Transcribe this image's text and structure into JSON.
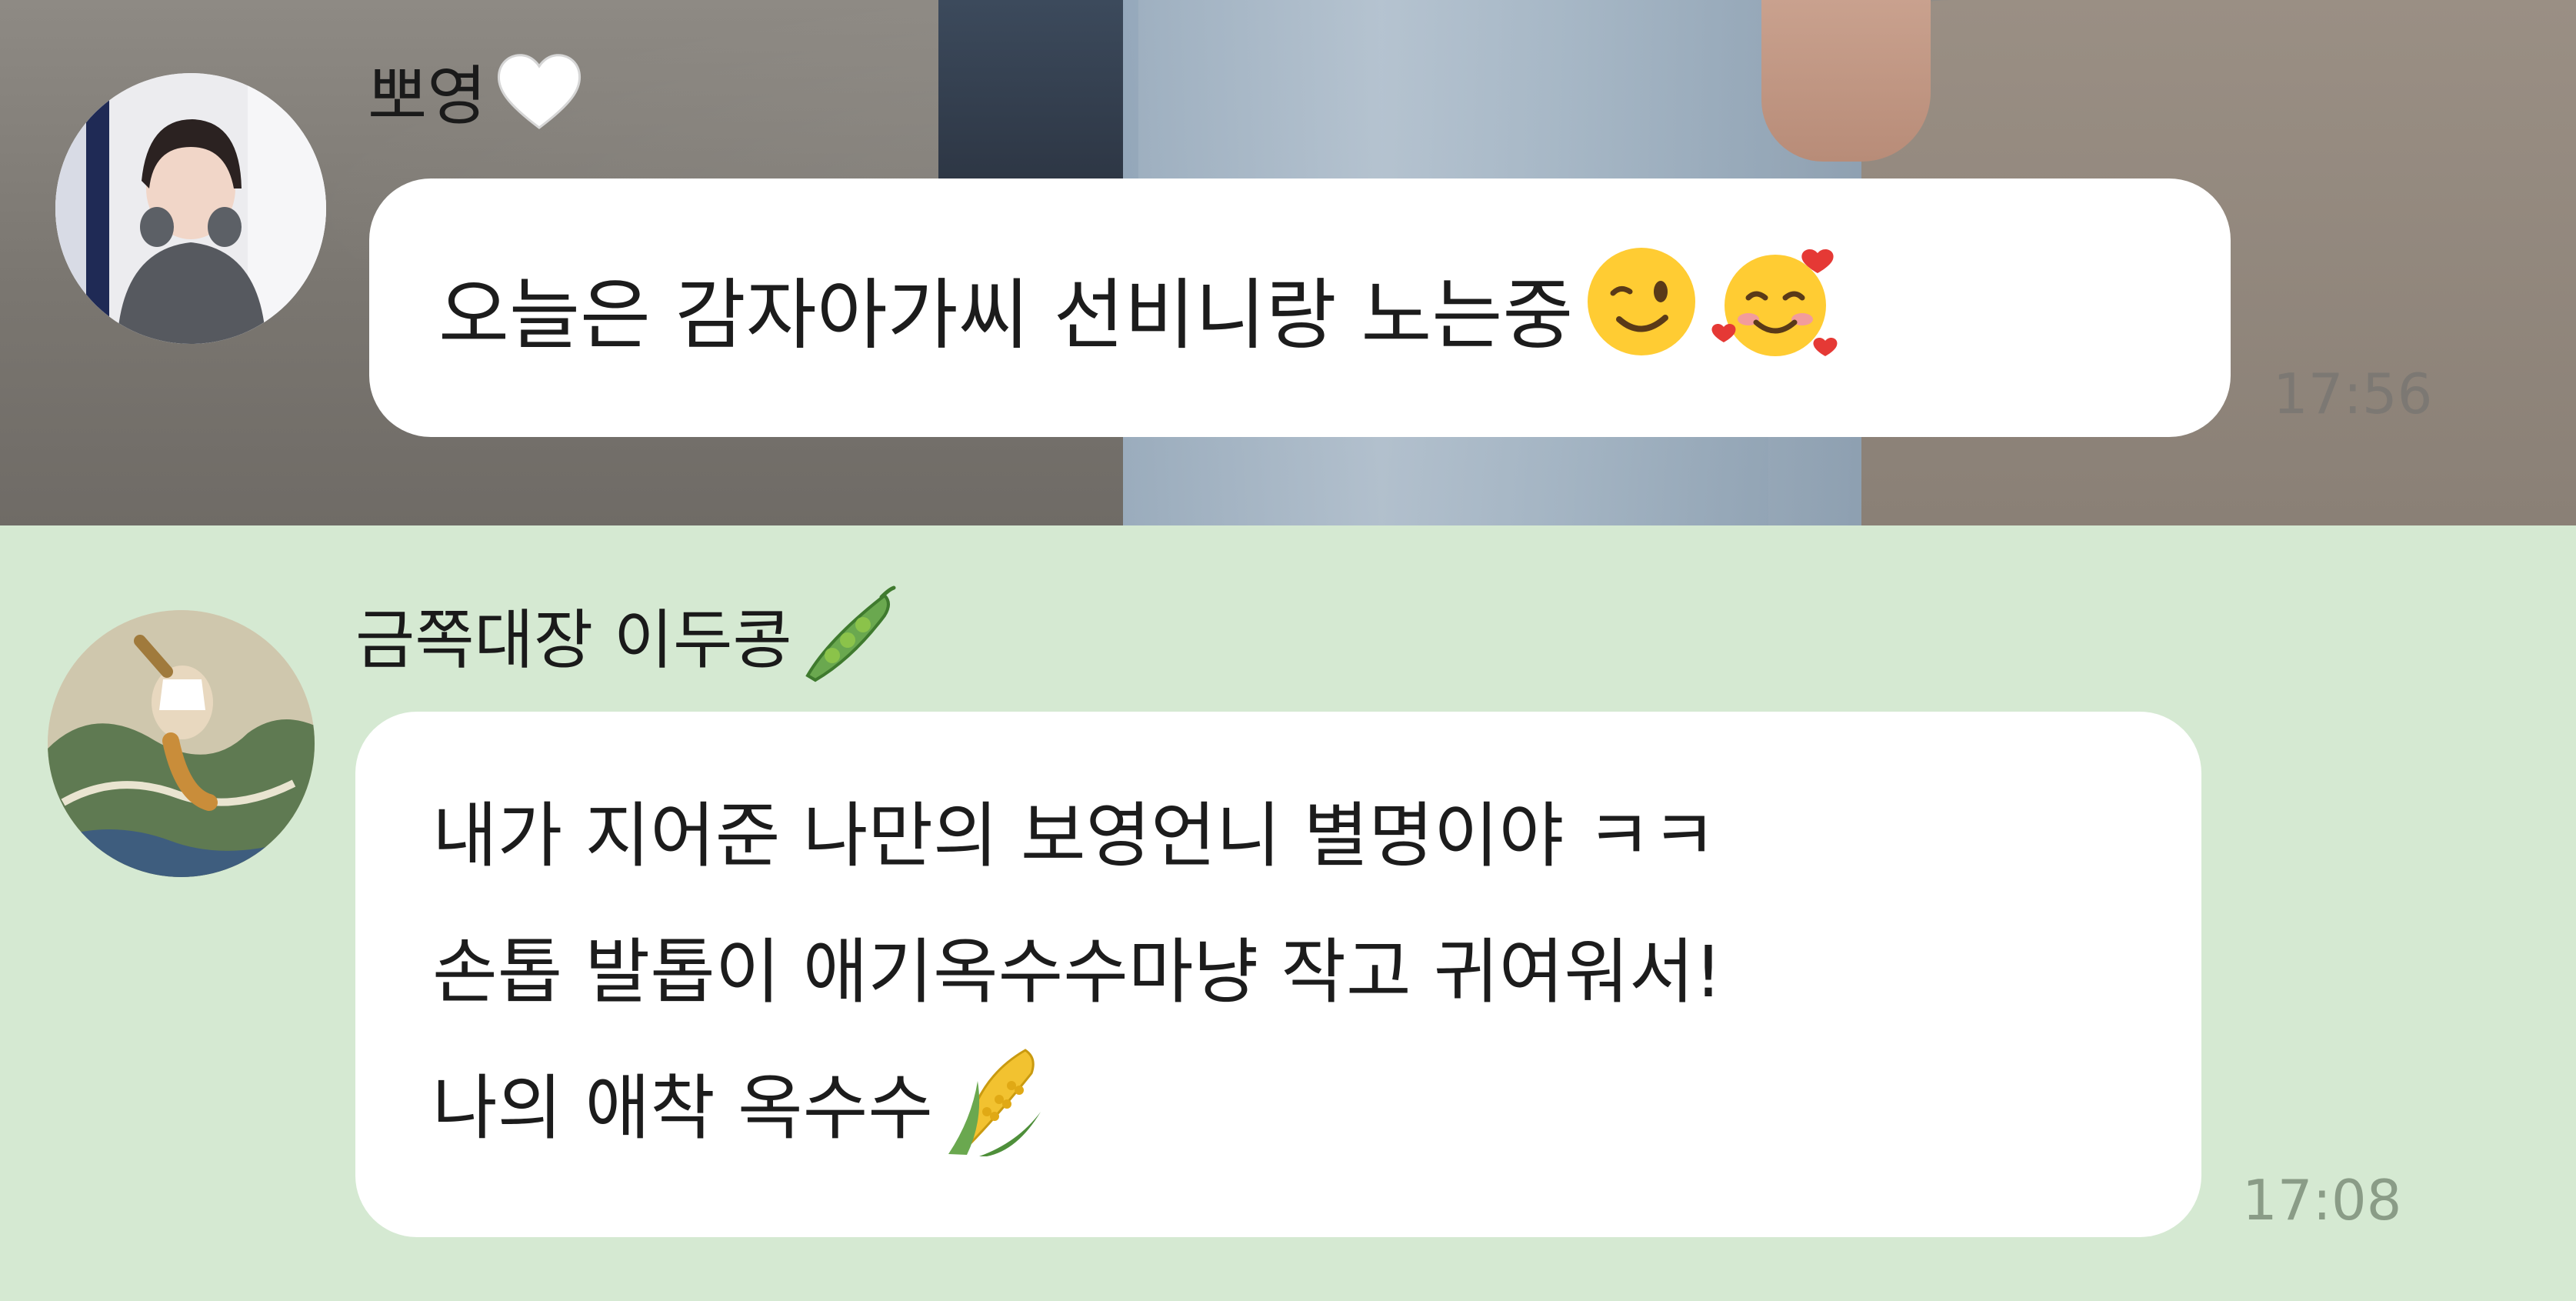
{
  "messages": [
    {
      "sender": "뽀영",
      "sender_icon": "white-heart-icon",
      "text": "오늘은 감자아가씨 선비니랑 노는중",
      "emojis": [
        "winking-face-icon",
        "smiling-face-with-hearts-icon"
      ],
      "time": "17:56"
    },
    {
      "sender": "금쪽대장 이두콩",
      "sender_icon": "pea-pod-icon",
      "lines": [
        "내가 지어준 나만의 보영언니 별명이야 ㅋㅋ",
        "손톱 발톱이 애기옥수수마냥 작고 귀여워서!",
        "나의 애착 옥수수"
      ],
      "emojis": [
        "corn-icon"
      ],
      "time": "17:08"
    }
  ],
  "colors": {
    "bubble": "#ffffff",
    "chat_background_bottom": "#d5e9d2",
    "timestamp": "#8c8c8c"
  }
}
